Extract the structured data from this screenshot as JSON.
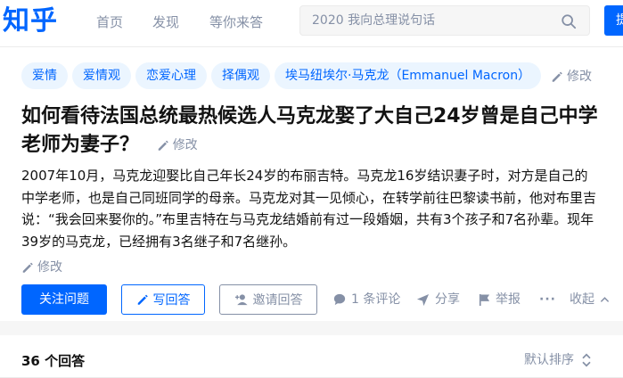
{
  "header": {
    "logo": "知乎",
    "nav": [
      "首页",
      "发现",
      "等你来答"
    ],
    "search_placeholder": "2020 我向总理说句话",
    "ask_label": "提"
  },
  "question": {
    "topics": [
      "爱情",
      "爱情观",
      "恋爱心理",
      "择偶观",
      "埃马纽埃尔·马克龙（Emmanuel Macron）"
    ],
    "edit_label": "修改",
    "title": "如何看待法国总统最热候选人马克龙娶了大自己24岁曾是自己中学老师为妻子？",
    "description": "2007年10月，马克龙迎娶比自己年长24岁的布丽吉特。马克龙16岁结识妻子时，对方是自己的中学老师，也是自己同班同学的母亲。马克龙对其一见倾心，在转学前往巴黎读书前，他对布里吉说：“我会回来娶你的。”布里吉特在与马克龙结婚前有过一段婚姻，共有3个孩子和7名孙辈。现年39岁的马克龙，已经拥有3名继子和7名继孙。"
  },
  "actions": {
    "follow": "关注问题",
    "write_answer": "写回答",
    "invite": "邀请回答",
    "comments": "1 条评论",
    "share": "分享",
    "report": "举报",
    "more": "···",
    "collapse": "收起"
  },
  "answers": {
    "count_label": "36 个回答",
    "sort_label": "默认排序"
  },
  "colors": {
    "brand": "#0066ff",
    "muted": "#8590a6",
    "tag_bg": "#ebf5ff"
  }
}
